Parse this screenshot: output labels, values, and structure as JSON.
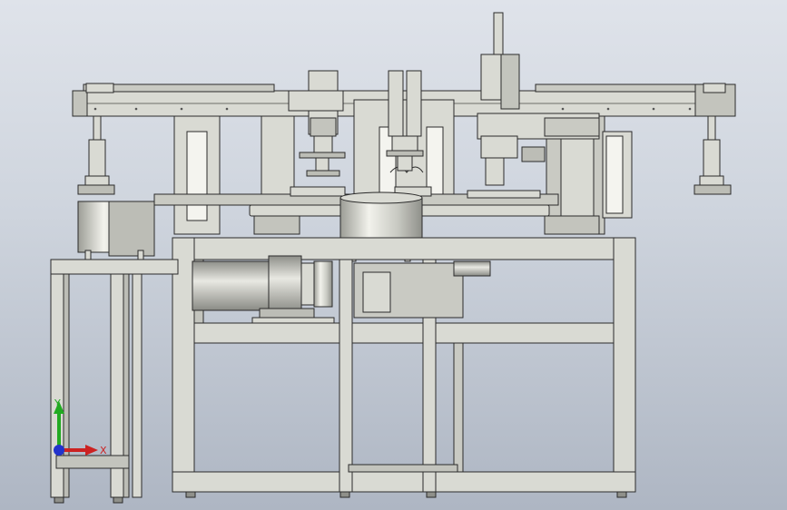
{
  "viewport": {
    "background_top": "#dfe3ea",
    "background_bottom": "#aeb6c3",
    "part_fill": "#d9dad3",
    "part_shade": "#a9aaa3",
    "edge_color": "#2b2b2b"
  },
  "triad": {
    "x_label": "X",
    "y_label": "Y",
    "x_color": "#cc2222",
    "y_color": "#22aa22",
    "z_color": "#2233cc",
    "icon": "coordinate-triad-icon"
  }
}
